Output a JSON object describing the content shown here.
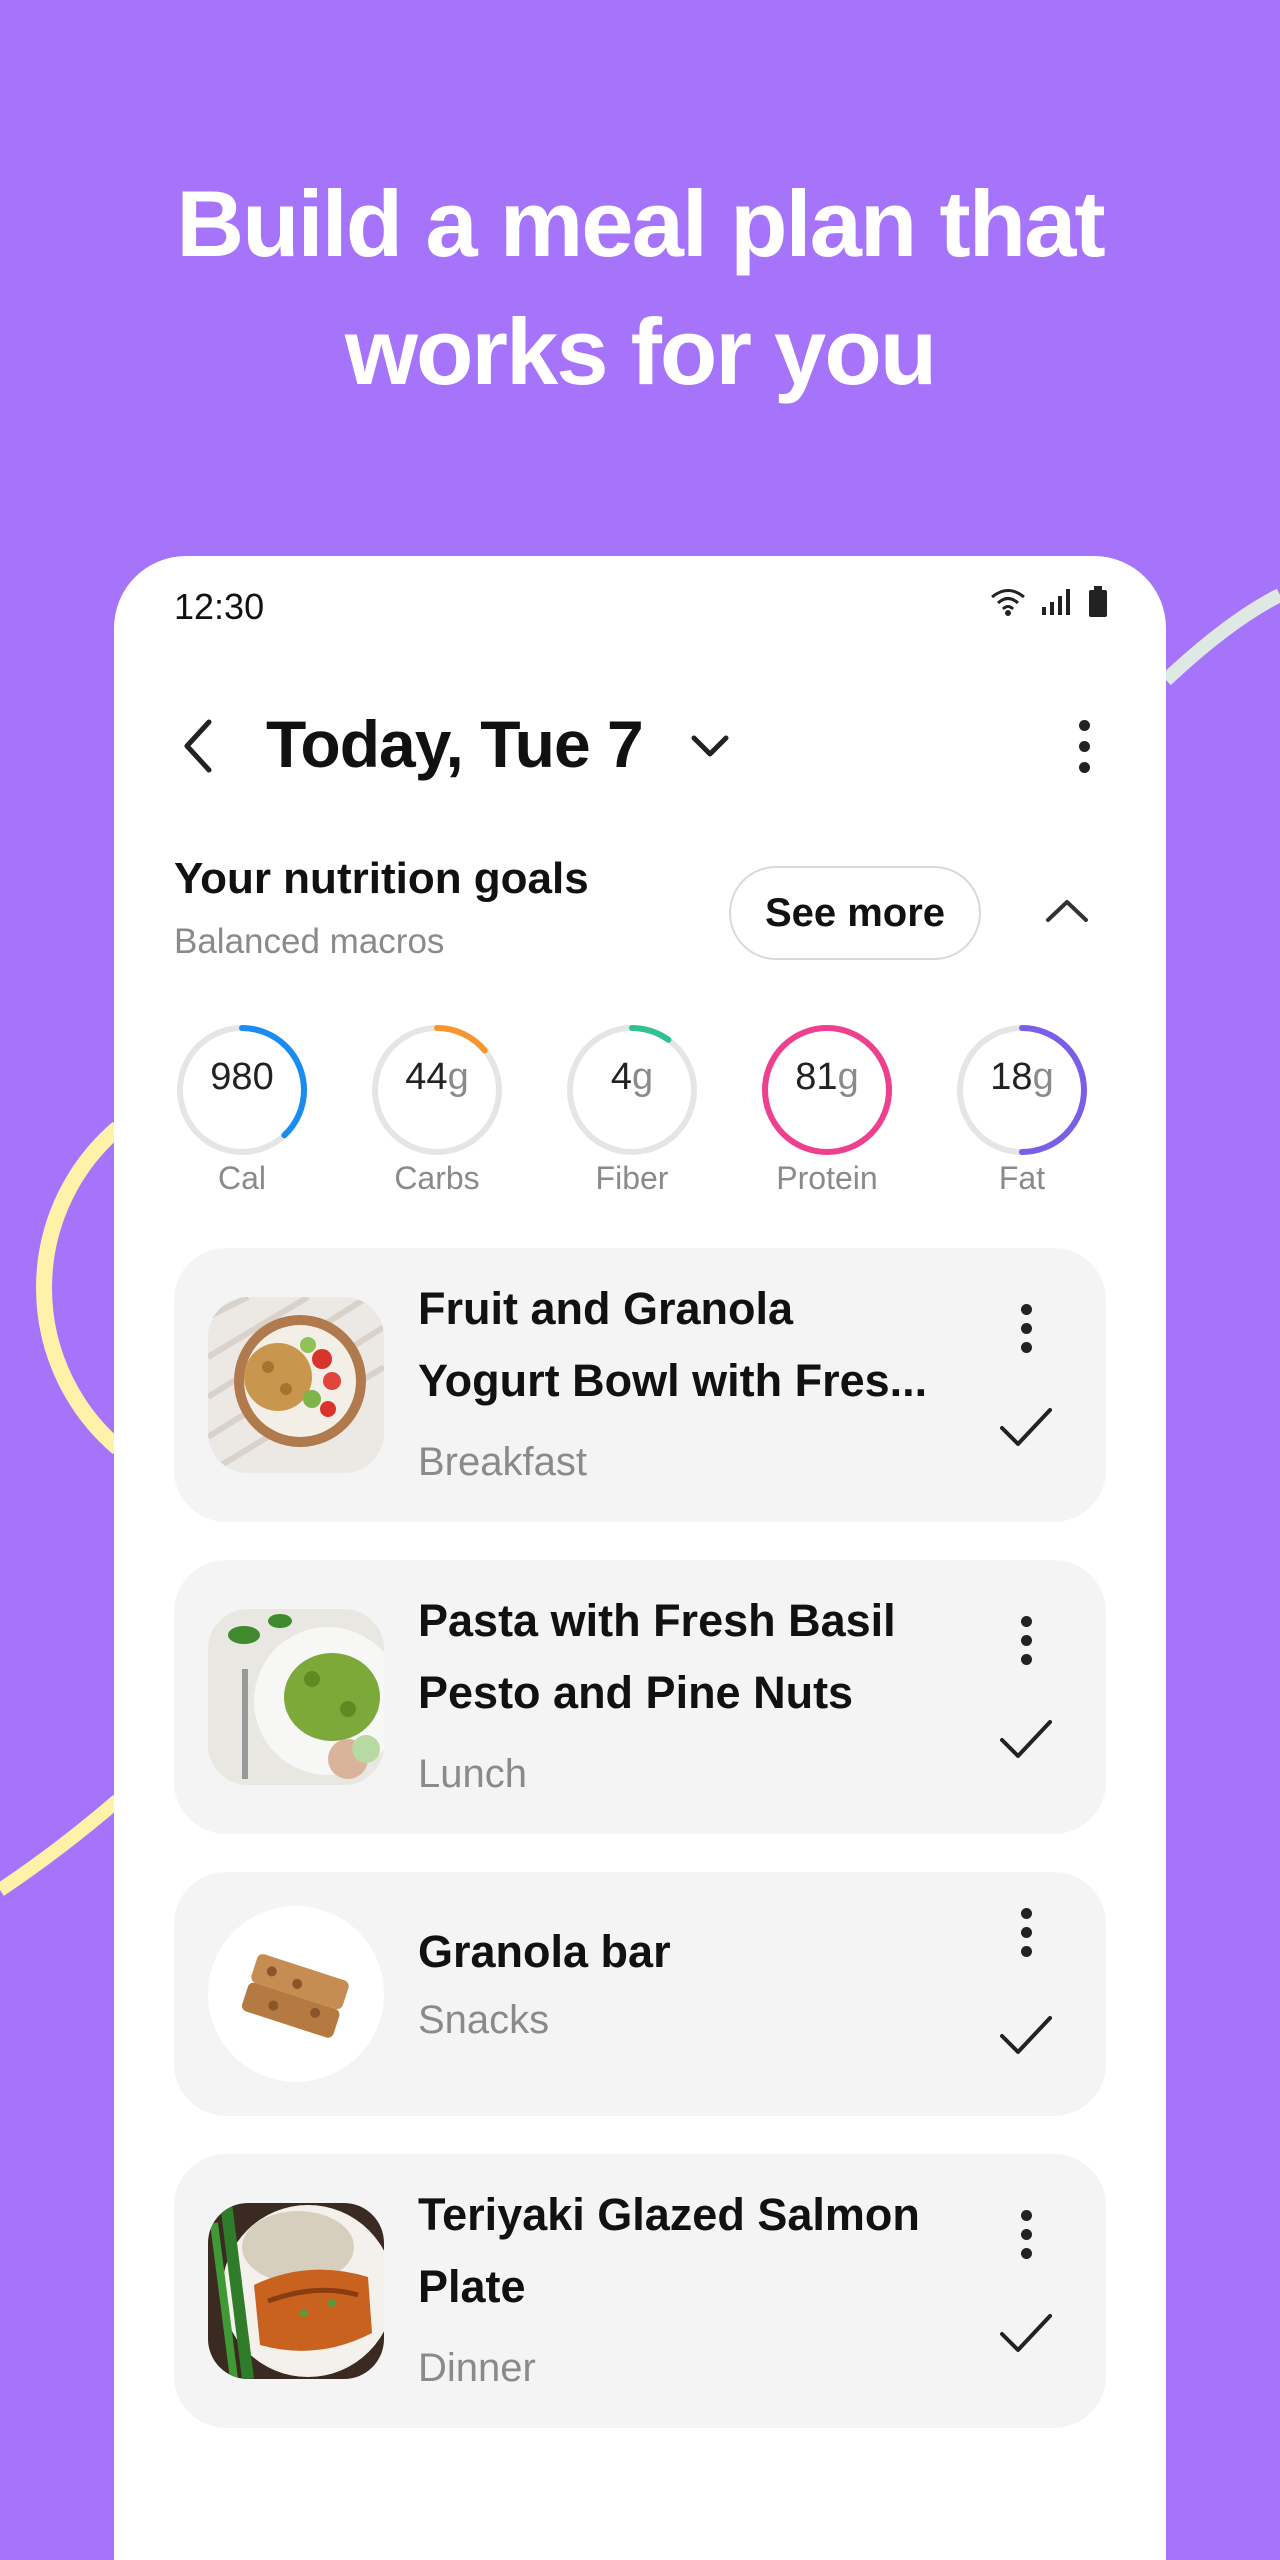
{
  "headline": {
    "line1": "Build a meal plan that",
    "line2": "works for you"
  },
  "status_bar": {
    "time": "12:30",
    "icons": [
      "wifi-icon",
      "signal-icon",
      "battery-icon"
    ]
  },
  "header": {
    "title": "Today, Tue 7",
    "back_icon": "chevron-left-icon",
    "dropdown_icon": "chevron-down-icon",
    "more_icon": "more-vertical-icon"
  },
  "nutrition": {
    "title": "Your nutrition goals",
    "subtitle": "Balanced macros",
    "see_more_label": "See more",
    "collapse_icon": "chevron-up-icon",
    "goals": [
      {
        "value": "980",
        "unit": "",
        "label": "Cal",
        "color": "#1a8cf0",
        "progress": 0.38
      },
      {
        "value": "44",
        "unit": "g",
        "label": "Carbs",
        "color": "#f7962e",
        "progress": 0.14
      },
      {
        "value": "4",
        "unit": "g",
        "label": "Fiber",
        "color": "#2fc28f",
        "progress": 0.1
      },
      {
        "value": "81",
        "unit": "g",
        "label": "Protein",
        "color": "#ef3f8f",
        "progress": 1.0
      },
      {
        "value": "18",
        "unit": "g",
        "label": "Fat",
        "color": "#7a5ee6",
        "progress": 0.5
      }
    ]
  },
  "meals": [
    {
      "title_line1": "Fruit and Granola",
      "title_line2": "Yogurt Bowl with Fres...",
      "type": "Breakfast",
      "image": "yogurt-bowl-image"
    },
    {
      "title_line1": "Pasta with Fresh Basil",
      "title_line2": "Pesto and Pine Nuts",
      "type": "Lunch",
      "image": "pesto-pasta-image"
    },
    {
      "title_line1": "Granola bar",
      "title_line2": "",
      "type": "Snacks",
      "image": "granola-bar-image"
    },
    {
      "title_line1": "Teriyaki Glazed Salmon",
      "title_line2": "Plate",
      "type": "Dinner",
      "image": "salmon-plate-image"
    }
  ],
  "colors": {
    "background": "#a673fb",
    "card": "#f4f4f4",
    "deco_yellow": "#fff1a8"
  }
}
